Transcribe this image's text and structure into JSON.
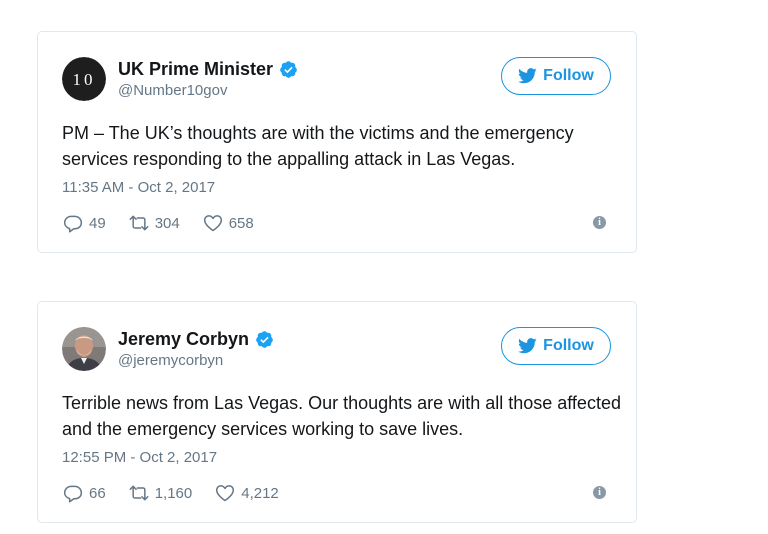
{
  "colors": {
    "brand": "#1b95e0",
    "verified": "#1da1f2",
    "secondary_text": "#657786",
    "border": "#e1e8ed"
  },
  "tweets": [
    {
      "author_name": "UK Prime Minister",
      "handle": "@Number10gov",
      "avatar_text": "10",
      "verified": true,
      "follow_label": "Follow",
      "text": "PM – The UK’s thoughts are with the victims and the emergency services responding to the appalling attack in Las Vegas.",
      "timestamp": "11:35 AM - Oct 2, 2017",
      "replies": "49",
      "retweets": "304",
      "likes": "658",
      "info_glyph": "i"
    },
    {
      "author_name": "Jeremy Corbyn",
      "handle": "@jeremycorbyn",
      "verified": true,
      "follow_label": "Follow",
      "text": "Terrible news from Las Vegas. Our thoughts are with all those affected and the emergency services working to save lives.",
      "timestamp": "12:55 PM - Oct 2, 2017",
      "replies": "66",
      "retweets": "1,160",
      "likes": "4,212",
      "info_glyph": "i"
    }
  ]
}
